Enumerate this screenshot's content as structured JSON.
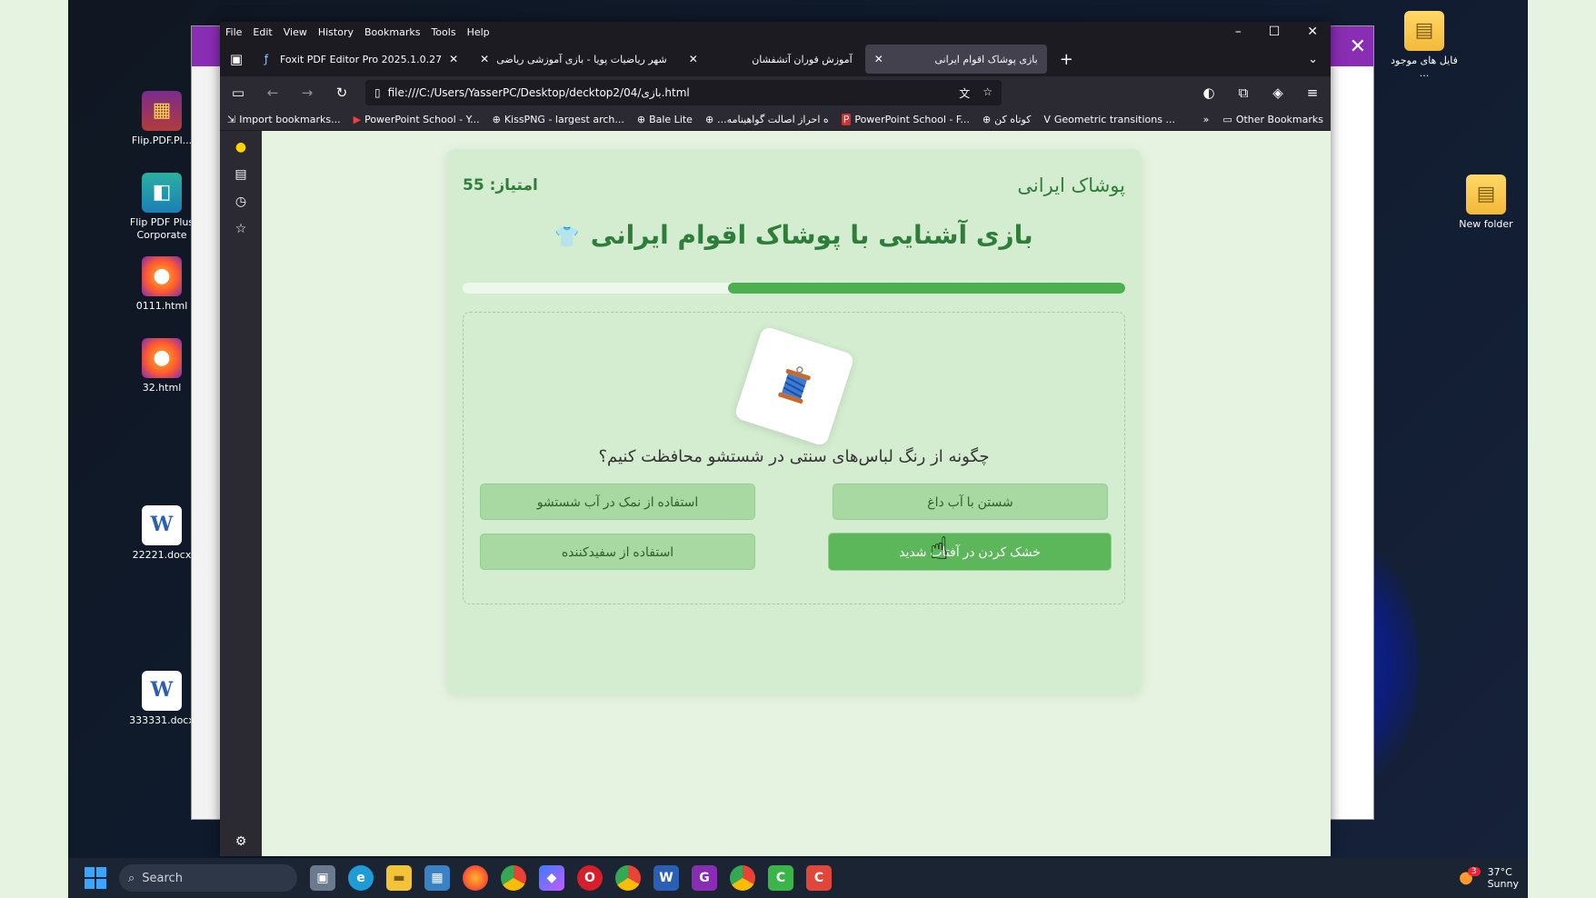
{
  "desktop": {
    "left_icons": [
      {
        "label": "Flip.PDF.Pl...",
        "glyph": "▦",
        "kind": "rar"
      },
      {
        "label": "Flip PDF Plus Corporate",
        "glyph": "◧",
        "kind": "flip"
      },
      {
        "label": "0111.html",
        "glyph": "●",
        "kind": "ff"
      },
      {
        "label": "32.html",
        "glyph": "●",
        "kind": "ff"
      },
      {
        "label": "22221.docx",
        "glyph": "W",
        "kind": "word"
      },
      {
        "label": "333331.docx",
        "glyph": "W",
        "kind": "word"
      }
    ],
    "right_icons": [
      {
        "label": "فایل های موجود ...",
        "glyph": "▤",
        "kind": "folder"
      },
      {
        "label": "New folder",
        "glyph": "▤",
        "kind": "folder"
      }
    ]
  },
  "browser": {
    "menu": [
      "File",
      "Edit",
      "View",
      "History",
      "Bookmarks",
      "Tools",
      "Help"
    ],
    "tabs": [
      {
        "title": "Foxit PDF Editor Pro 2025.1.0.27",
        "icon": "foxit"
      },
      {
        "title": "شهر ریاضیات پویا - بازی آموزشی ریاضی",
        "icon": "none"
      },
      {
        "title": "آموزش فوران آتشفشان",
        "icon": "none"
      },
      {
        "title": "بازی پوشاک اقوام ایرانی",
        "icon": "none",
        "active": true
      }
    ],
    "url": "file:///C:/Users/YasserPC/Desktop/decktop2/04/بازی.html",
    "bookmarks": [
      {
        "label": "Import bookmarks...",
        "icon": "⇲"
      },
      {
        "label": "PowerPoint School - Y...",
        "icon": "▶"
      },
      {
        "label": "KissPNG - largest arch...",
        "icon": "⊕"
      },
      {
        "label": "Bale Lite",
        "icon": "⊕"
      },
      {
        "label": "...ه احراز اصالت گواهینامه",
        "icon": "⊕"
      },
      {
        "label": "PowerPoint School - F...",
        "icon": "P"
      },
      {
        "label": "کوتاه کن",
        "icon": "⊕"
      },
      {
        "label": "Geometric transitions ...",
        "icon": "V"
      }
    ],
    "other_bookmarks": "Other Bookmarks"
  },
  "game": {
    "brand": "پوشاک ایرانی",
    "score": "امتیاز: 55",
    "title": "بازی آشنایی با پوشاک اقوام ایرانی",
    "progress": 0.6,
    "question": "چگونه از رنگ لباس‌های سنتی در شستشو محافظت کنیم؟",
    "options": [
      "شستن با آب داغ",
      "استفاده از نمک در آب شستشو",
      "خشک کردن در آفتاب شدید",
      "استفاده از سفیدکننده"
    ],
    "hovered_option": 2
  },
  "taskbar": {
    "search_placeholder": "Search",
    "weather_temp": "37°C",
    "weather_desc": "Sunny",
    "notification_count": "3"
  },
  "colors": {
    "accent_green": "#4caf50",
    "title_green": "#2f7d3a",
    "option_bg": "#a8d9a3",
    "option_hover": "#5cb75a",
    "page_bg": "#e6f3e0"
  }
}
